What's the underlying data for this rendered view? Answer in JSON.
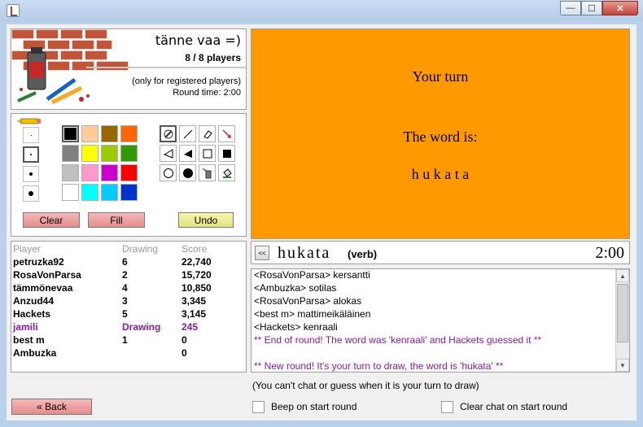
{
  "window": {
    "minimize": "—",
    "maximize": "☐",
    "close": "✕"
  },
  "room": {
    "name": "tänne vaa =)",
    "players": "8 / 8 players",
    "note": "(only for registered players)",
    "round_time": "Round time: 2:00"
  },
  "tools": {
    "colors": [
      "#000000",
      "#ffcc99",
      "#996600",
      "#ff6600",
      "#808080",
      "#ffff00",
      "#99cc00",
      "#339900",
      "#c0c0c0",
      "#ff99cc",
      "#cc00cc",
      "#ff0000",
      "#ffffff",
      "#00ffff",
      "#00ccff",
      "#0033cc"
    ],
    "selected_color": "#000000",
    "tool_icons": [
      "pencil-icon",
      "line-icon",
      "eraser-icon",
      "arrow-icon",
      "triangle-outline-icon",
      "triangle-filled-icon",
      "rectangle-outline-icon",
      "rectangle-filled-icon",
      "circle-outline-icon",
      "circle-filled-icon",
      "spray-icon",
      "fill-bucket-icon"
    ],
    "selected_tool": "pencil-icon",
    "clear_label": "Clear",
    "fill_label": "Fill",
    "undo_label": "Undo"
  },
  "scores": {
    "headers": {
      "player": "Player",
      "drawing": "Drawing",
      "score": "Score"
    },
    "rows": [
      {
        "player": "petruzka92",
        "drawing": "6",
        "score": "22,740"
      },
      {
        "player": "RosaVonParsa",
        "drawing": "2",
        "score": "15,720"
      },
      {
        "player": "tämmönevaa",
        "drawing": "4",
        "score": "10,850"
      },
      {
        "player": "Anzud44",
        "drawing": "3",
        "score": "3,345"
      },
      {
        "player": "Hackets",
        "drawing": "5",
        "score": "3,145"
      },
      {
        "player": "jamili",
        "drawing": "Drawing",
        "score": "245"
      },
      {
        "player": "best m",
        "drawing": "1",
        "score": "0"
      },
      {
        "player": "Ambuzka",
        "drawing": "",
        "score": "0"
      }
    ]
  },
  "back_label": "« Back",
  "canvas": {
    "your_turn": "Your turn",
    "word_is": "The word is:",
    "word": "h u k a t a"
  },
  "wordbar": {
    "collapse": "<<",
    "word": "hukata",
    "type": "(verb)",
    "timer": "2:00"
  },
  "chat": {
    "lines": [
      "<RosaVonParsa> kersantti",
      "<Ambuzka> sotilas",
      "<RosaVonParsa> alokas",
      "<best m> mattimeikäläinen",
      "<Hackets> kenraali",
      "** End of round! The word was 'kenraali' and Hackets guessed it **",
      "",
      "** New round! It's your turn to draw, the word is 'hukata' **"
    ],
    "note": "(You can't chat or guess when it is your turn to draw)",
    "beep_label": "Beep on start round",
    "clear_label": "Clear chat on start round"
  }
}
